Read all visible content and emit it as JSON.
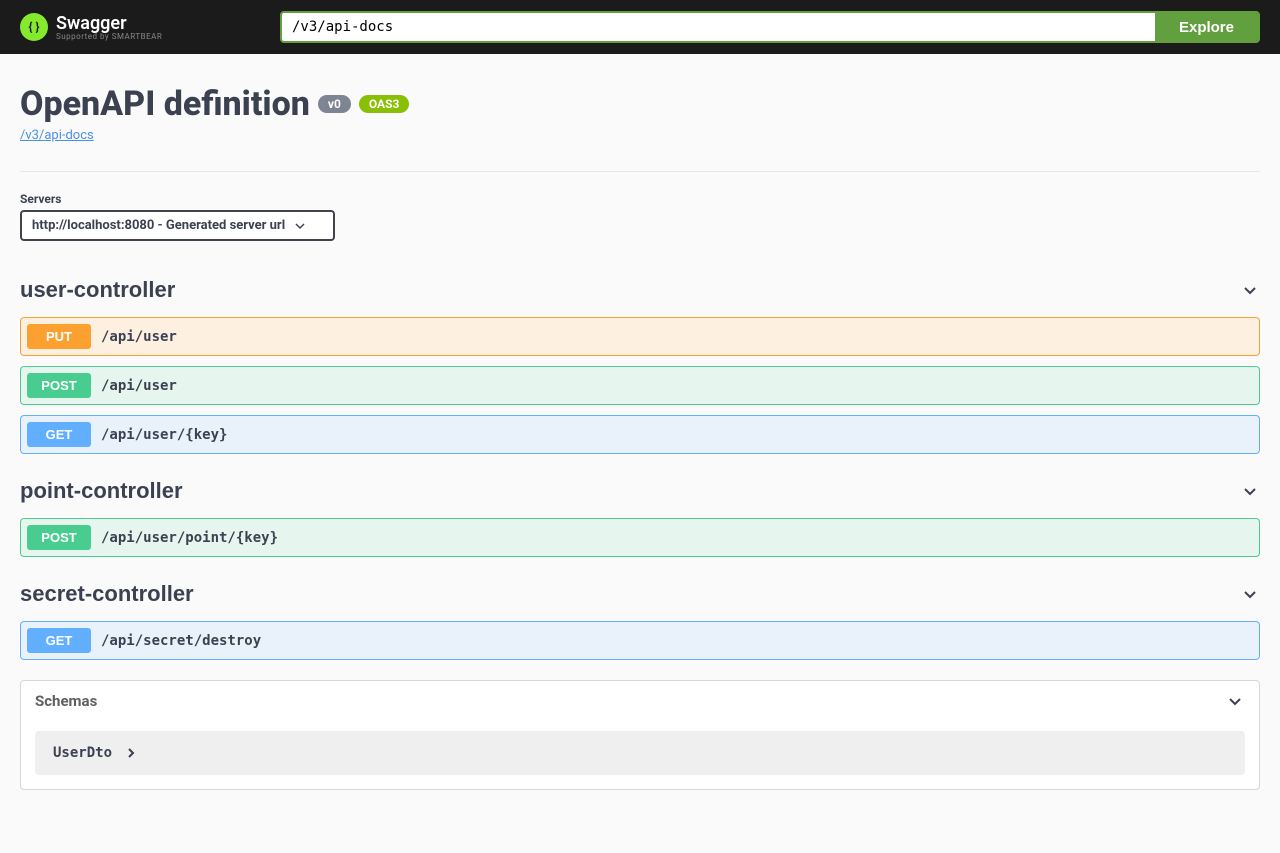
{
  "topbar": {
    "logo_text": "Swagger",
    "logo_sub": "Supported by SMARTBEAR",
    "search_value": "/v3/api-docs",
    "explore_label": "Explore"
  },
  "header": {
    "title": "OpenAPI definition",
    "version_badge": "v0",
    "oas_badge": "OAS3",
    "spec_link": "/v3/api-docs"
  },
  "servers": {
    "label": "Servers",
    "selected": "http://localhost:8080 - Generated server url"
  },
  "tags": [
    {
      "name": "user-controller",
      "operations": [
        {
          "method": "PUT",
          "method_class": "put",
          "path": "/api/user"
        },
        {
          "method": "POST",
          "method_class": "post",
          "path": "/api/user"
        },
        {
          "method": "GET",
          "method_class": "get",
          "path": "/api/user/{key}"
        }
      ]
    },
    {
      "name": "point-controller",
      "operations": [
        {
          "method": "POST",
          "method_class": "post",
          "path": "/api/user/point/{key}"
        }
      ]
    },
    {
      "name": "secret-controller",
      "operations": [
        {
          "method": "GET",
          "method_class": "get",
          "path": "/api/secret/destroy"
        }
      ]
    }
  ],
  "schemas": {
    "title": "Schemas",
    "items": [
      {
        "name": "UserDto"
      }
    ]
  }
}
